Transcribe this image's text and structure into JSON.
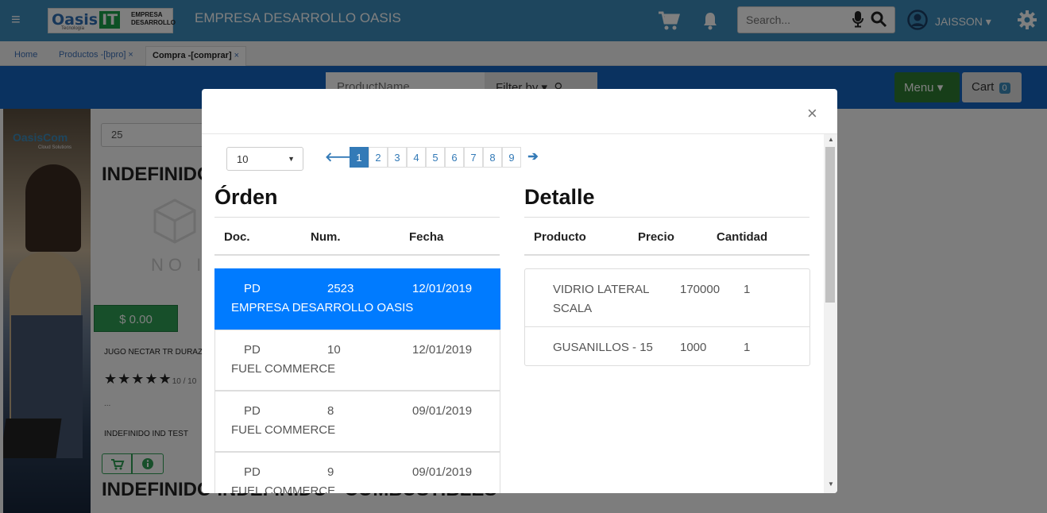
{
  "topnav": {
    "logo_text": "Oasis",
    "logo_it": "IT",
    "logo_sub": "Tecnología",
    "logo_brand": "EMPRESA DESARROLLO",
    "company": "EMPRESA DESARROLLO OASIS",
    "search_placeholder": "Search...",
    "user": "JAISSON"
  },
  "tabs": [
    {
      "label": "Home"
    },
    {
      "label": "Productos -[bpro]",
      "close": "×"
    },
    {
      "label": "Compra -[comprar]",
      "close": "×"
    }
  ],
  "filterbar": {
    "product_placeholder": "ProductName",
    "filter_label": "Filter by",
    "menu_label": "Menu",
    "cart_label": "Cart",
    "cart_count": "0"
  },
  "background": {
    "brand": "OasisCom",
    "brand_sub": "Cloud Solutions",
    "page_size": "25",
    "category_title": "INDEFINIDO",
    "no_image": "NO I",
    "price": "$ 0.00",
    "product_name": "JUGO NECTAR TR DURAZ",
    "rating": "10 / 10",
    "ellipsis": "...",
    "product_category": "INDEFINIDO IND TEST",
    "category_title_2": "INDEFINIDO   INDEFINIDO - COMBUSTIBLES"
  },
  "modal": {
    "close": "×",
    "page_size": "10",
    "pages": [
      "1",
      "2",
      "3",
      "4",
      "5",
      "6",
      "7",
      "8",
      "9"
    ],
    "active_page": "1",
    "orden_title": "Órden",
    "detalle_title": "Detalle",
    "orden_headers": [
      "Doc.",
      "Num.",
      "Fecha"
    ],
    "detalle_headers": [
      "Producto",
      "Precio",
      "Cantidad"
    ],
    "ordenes": [
      {
        "doc": "PD",
        "num": "2523",
        "fecha": "12/01/2019",
        "empresa": "EMPRESA DESARROLLO OASIS"
      },
      {
        "doc": "PD",
        "num": "10",
        "fecha": "12/01/2019",
        "empresa": "FUEL COMMERCE"
      },
      {
        "doc": "PD",
        "num": "8",
        "fecha": "09/01/2019",
        "empresa": "FUEL COMMERCE"
      },
      {
        "doc": "PD",
        "num": "9",
        "fecha": "09/01/2019",
        "empresa": "FUEL COMMERCE"
      }
    ],
    "detalles": [
      {
        "producto": "VIDRIO LATERAL SCALA",
        "precio": "170000",
        "cantidad": "1"
      },
      {
        "producto": "GUSANILLOS - 15",
        "precio": "1000",
        "cantidad": "1"
      }
    ]
  },
  "colors": {
    "topnav": "#3c8dbc",
    "bluebar": "#1565c0",
    "active_row": "#007bff",
    "menu_button": "#2e7d32",
    "price_button": "#2e9e55"
  }
}
